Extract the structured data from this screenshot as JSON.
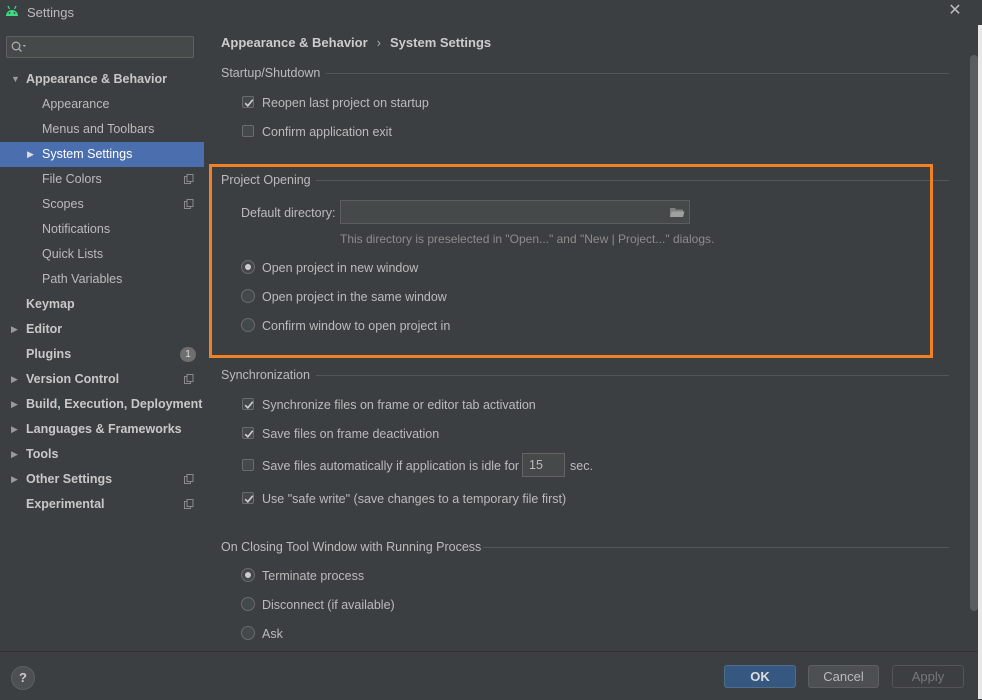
{
  "window": {
    "title": "Settings",
    "close_glyph": "✕"
  },
  "sidebar": {
    "search_placeholder": "",
    "items": [
      {
        "label": "Appearance & Behavior",
        "level": 0,
        "bold": true,
        "expanded": true
      },
      {
        "label": "Appearance",
        "level": 1
      },
      {
        "label": "Menus and Toolbars",
        "level": 1
      },
      {
        "label": "System Settings",
        "level": 1,
        "selected": true,
        "has_arrow": true
      },
      {
        "label": "File Colors",
        "level": 1,
        "icon": "copy-icon"
      },
      {
        "label": "Scopes",
        "level": 1,
        "icon": "copy-icon"
      },
      {
        "label": "Notifications",
        "level": 1
      },
      {
        "label": "Quick Lists",
        "level": 1
      },
      {
        "label": "Path Variables",
        "level": 1
      },
      {
        "label": "Keymap",
        "level": 0,
        "bold": true
      },
      {
        "label": "Editor",
        "level": 0,
        "bold": true,
        "has_arrow": true
      },
      {
        "label": "Plugins",
        "level": 0,
        "bold": true,
        "badge": "1"
      },
      {
        "label": "Version Control",
        "level": 0,
        "bold": true,
        "has_arrow": true,
        "icon": "copy-icon"
      },
      {
        "label": "Build, Execution, Deployment",
        "level": 0,
        "bold": true,
        "has_arrow": true
      },
      {
        "label": "Languages & Frameworks",
        "level": 0,
        "bold": true,
        "has_arrow": true
      },
      {
        "label": "Tools",
        "level": 0,
        "bold": true,
        "has_arrow": true
      },
      {
        "label": "Other Settings",
        "level": 0,
        "bold": true,
        "has_arrow": true,
        "icon": "copy-icon"
      },
      {
        "label": "Experimental",
        "level": 0,
        "bold": true,
        "icon": "copy-icon"
      }
    ]
  },
  "breadcrumb": {
    "parent": "Appearance & Behavior",
    "separator": "›",
    "current": "System Settings"
  },
  "startup": {
    "title": "Startup/Shutdown",
    "reopen_label": "Reopen last project on startup",
    "reopen_checked": true,
    "confirm_exit_label": "Confirm application exit",
    "confirm_exit_checked": false
  },
  "project_opening": {
    "title": "Project Opening",
    "default_dir_label": "Default directory:",
    "default_dir_value": "",
    "hint": "This directory is preselected in \"Open...\" and \"New | Project...\" dialogs.",
    "options": [
      "Open project in new window",
      "Open project in the same window",
      "Confirm window to open project in"
    ],
    "selected_index": 0
  },
  "synchronization": {
    "title": "Synchronization",
    "sync_files_label": "Synchronize files on frame or editor tab activation",
    "sync_files_checked": true,
    "save_deactivation_label": "Save files on frame deactivation",
    "save_deactivation_checked": true,
    "save_idle_label": "Save files automatically if application is idle for",
    "save_idle_checked": false,
    "idle_value": "15",
    "idle_unit": "sec.",
    "safe_write_label": "Use \"safe write\" (save changes to a temporary file first)",
    "safe_write_checked": true
  },
  "closing": {
    "title": "On Closing Tool Window with Running Process",
    "options": [
      "Terminate process",
      "Disconnect (if available)",
      "Ask"
    ],
    "selected_index": 0
  },
  "buttons": {
    "help": "?",
    "ok": "OK",
    "cancel": "Cancel",
    "apply": "Apply"
  },
  "colors": {
    "accent_highlight": "#f08125",
    "selection": "#4b6eaf",
    "ok_button": "#365880"
  }
}
